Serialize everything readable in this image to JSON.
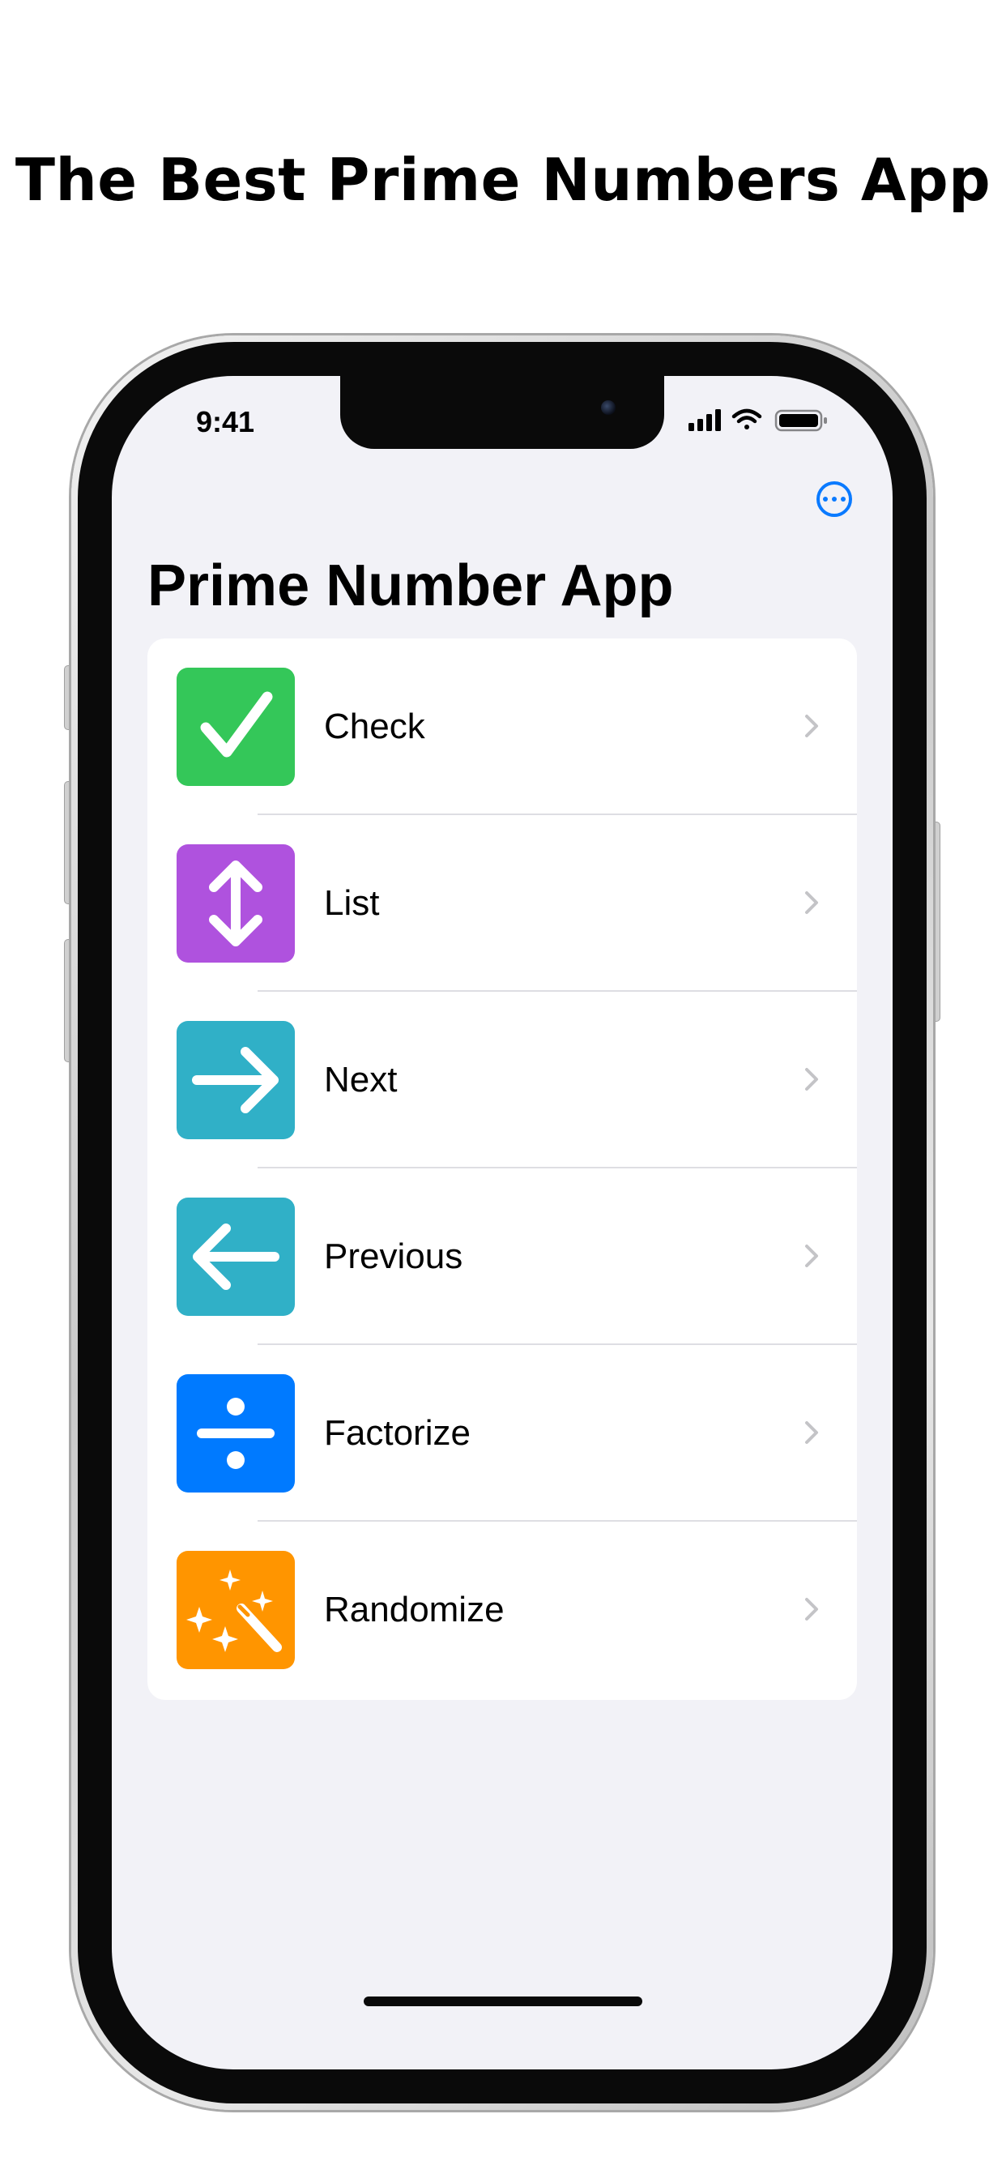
{
  "headline": "The Best Prime Numbers App",
  "status_bar": {
    "time": "9:41"
  },
  "nav": {
    "title": "Prime Number App",
    "more_icon": "ellipsis-circle-icon"
  },
  "menu": [
    {
      "label": "Check",
      "icon": "checkmark-icon",
      "color": "#34c759"
    },
    {
      "label": "List",
      "icon": "arrow-up-down-icon",
      "color": "#af52de"
    },
    {
      "label": "Next",
      "icon": "arrow-right-icon",
      "color": "#30b0c7"
    },
    {
      "label": "Previous",
      "icon": "arrow-left-icon",
      "color": "#30b0c7"
    },
    {
      "label": "Factorize",
      "icon": "divide-icon",
      "color": "#007aff"
    },
    {
      "label": "Randomize",
      "icon": "magic-wand-icon",
      "color": "#ff9500"
    }
  ],
  "accent_color": "#007aff"
}
